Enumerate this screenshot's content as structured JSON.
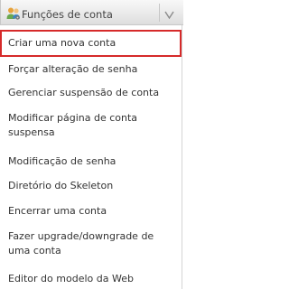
{
  "header": {
    "title": "Funções de conta",
    "icon": "users-gear-icon",
    "toggle_icon": "chevron-down-icon"
  },
  "items": [
    {
      "label": "Criar uma nova conta",
      "selected": true
    },
    {
      "label": "Forçar alteração de senha"
    },
    {
      "label": "Gerenciar suspensão de conta"
    },
    {
      "label": "Modificar página de conta suspensa"
    },
    {
      "label": "Modificação de senha"
    },
    {
      "label": "Diretório do Skeleton"
    },
    {
      "label": "Encerrar uma conta"
    },
    {
      "label": "Fazer upgrade/downgrade de uma conta"
    },
    {
      "label": "Editor do modelo da Web"
    }
  ],
  "colors": {
    "selected_border": "#d62a2a",
    "text": "#333333"
  }
}
